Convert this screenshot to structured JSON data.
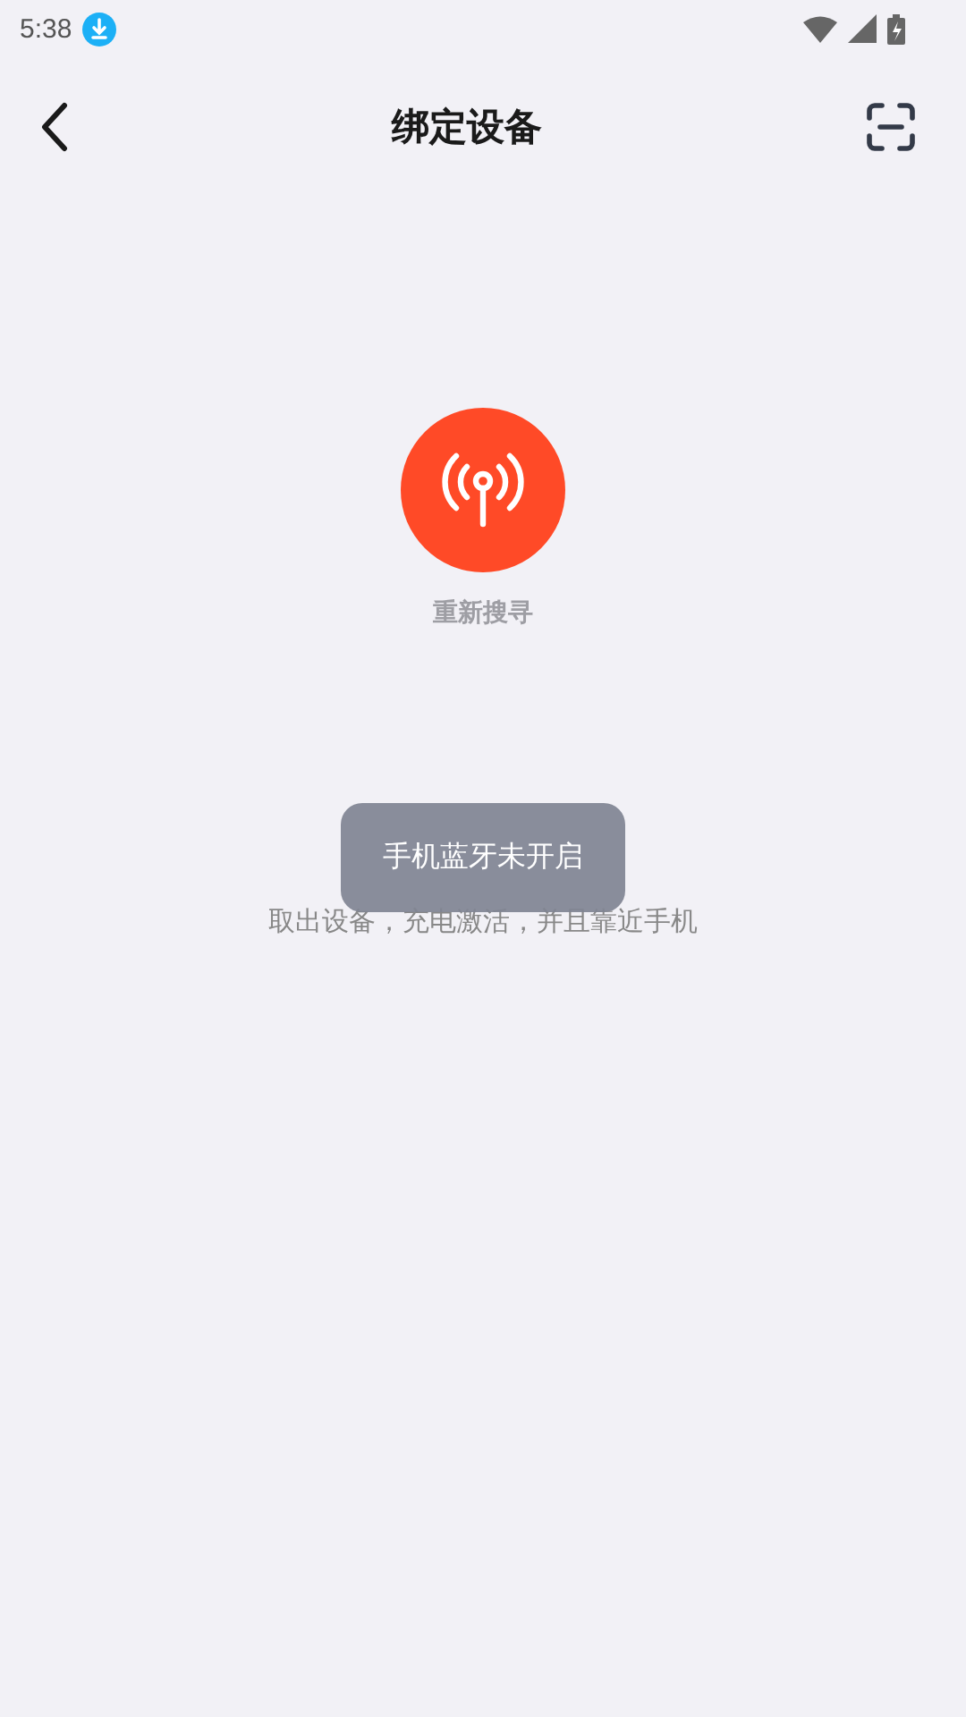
{
  "status_bar": {
    "time": "5:38"
  },
  "header": {
    "title": "绑定设备"
  },
  "search": {
    "button_label": "重新搜寻",
    "hint": "取出设备，充电激活，并且靠近手机"
  },
  "toast": {
    "message": "手机蓝牙未开启"
  }
}
